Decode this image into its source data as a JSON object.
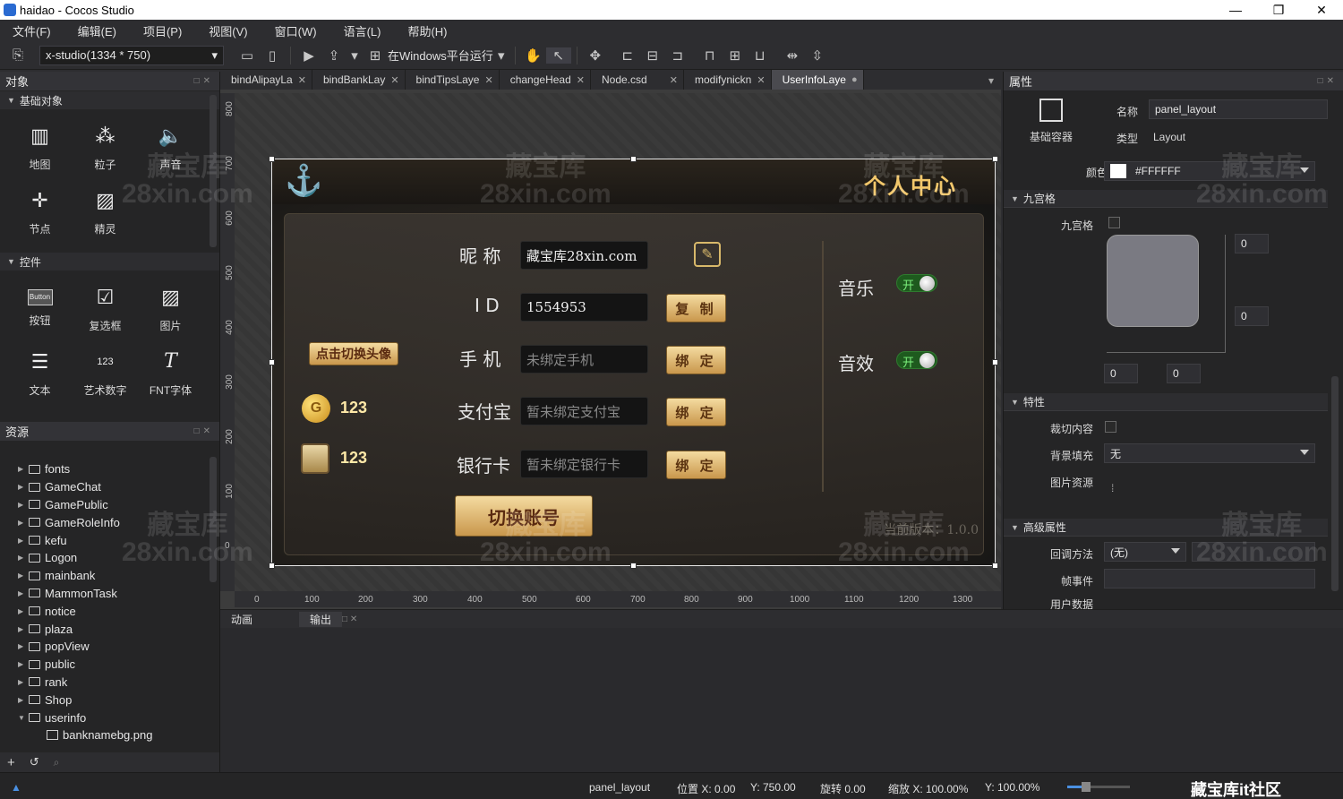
{
  "window": {
    "title": "haidao - Cocos Studio",
    "min": "—",
    "restore": "❐",
    "close": "✕"
  },
  "menu": [
    "文件(F)",
    "编辑(E)",
    "项目(P)",
    "视图(V)",
    "窗口(W)",
    "语言(L)",
    "帮助(H)"
  ],
  "toolbar": {
    "resolution": "x-studio(1334 * 750)",
    "run_label": "在Windows平台运行"
  },
  "left": {
    "objects_title": "对象",
    "basic_section": "基础对象",
    "basic_items": [
      {
        "label": "地图",
        "icon": "map-icon",
        "glyph": "▥"
      },
      {
        "label": "粒子",
        "icon": "particle-icon",
        "glyph": "⁂"
      },
      {
        "label": "声音",
        "icon": "sound-icon",
        "glyph": "🔈"
      },
      {
        "label": "节点",
        "icon": "node-icon",
        "glyph": "✛"
      },
      {
        "label": "精灵",
        "icon": "sprite-icon",
        "glyph": "▨"
      }
    ],
    "controls_section": "控件",
    "control_items": [
      {
        "label": "按钮",
        "icon": "button-icon",
        "glyph": "Button"
      },
      {
        "label": "复选框",
        "icon": "checkbox-icon",
        "glyph": "☑"
      },
      {
        "label": "图片",
        "icon": "image-icon",
        "glyph": "▨"
      },
      {
        "label": "文本",
        "icon": "text-icon",
        "glyph": "☰"
      },
      {
        "label": "艺术数字",
        "icon": "art-number-icon",
        "glyph": "123"
      },
      {
        "label": "FNT字体",
        "icon": "fnt-font-icon",
        "glyph": "T"
      }
    ],
    "resources_title": "资源",
    "resources": [
      {
        "name": "fonts",
        "type": "folder"
      },
      {
        "name": "GameChat",
        "type": "folder"
      },
      {
        "name": "GamePublic",
        "type": "folder"
      },
      {
        "name": "GameRoleInfo",
        "type": "folder"
      },
      {
        "name": "kefu",
        "type": "folder"
      },
      {
        "name": "Logon",
        "type": "folder"
      },
      {
        "name": "mainbank",
        "type": "folder"
      },
      {
        "name": "MammonTask",
        "type": "folder"
      },
      {
        "name": "notice",
        "type": "folder"
      },
      {
        "name": "plaza",
        "type": "folder"
      },
      {
        "name": "popView",
        "type": "folder"
      },
      {
        "name": "public",
        "type": "folder"
      },
      {
        "name": "rank",
        "type": "folder"
      },
      {
        "name": "Shop",
        "type": "folder"
      },
      {
        "name": "userinfo",
        "type": "folder-open"
      },
      {
        "name": "banknamebg.png",
        "type": "image"
      }
    ],
    "add_label": "+",
    "refresh_label": "↺"
  },
  "tabs": [
    {
      "label": "bindAlipayLa",
      "active": false
    },
    {
      "label": "bindBankLay",
      "active": false
    },
    {
      "label": "bindTipsLaye",
      "active": false
    },
    {
      "label": "changeHead",
      "active": false
    },
    {
      "label": "Node.csd",
      "active": false
    },
    {
      "label": "modifynickn",
      "active": false
    },
    {
      "label": "UserInfoLaye",
      "active": true
    }
  ],
  "ruler": {
    "v_labels": [
      "800",
      "700",
      "600",
      "500",
      "400",
      "300",
      "200",
      "100",
      "0"
    ],
    "h_labels": [
      "0",
      "100",
      "200",
      "300",
      "400",
      "500",
      "600",
      "700",
      "800",
      "900",
      "1000",
      "1100",
      "1200",
      "1300"
    ]
  },
  "design": {
    "banner_title": "个人中心",
    "nickname_label": "昵  称",
    "nickname_value": "藏宝库28xin.com",
    "id_label": "I  D",
    "id_value": "1554953",
    "copy_button": "复 制",
    "phone_label": "手  机",
    "phone_placeholder": "未绑定手机",
    "alipay_label": "支付宝",
    "alipay_placeholder": "暂未绑定支付宝",
    "bankcard_label": "银行卡",
    "bankcard_placeholder": "暂未绑定银行卡",
    "bind_button": "绑 定",
    "switch_avatar_button": "点击切换头像",
    "coin_amount": "123",
    "bank_amount": "123",
    "music_label": "音乐",
    "sfx_label": "音效",
    "toggle_on": "开",
    "switch_account_button": "切换账号",
    "version": "当前版本：1.0.0"
  },
  "bottom": {
    "anim_tab": "动画",
    "output_tab": "输出"
  },
  "props": {
    "title": "属性",
    "container_label": "基础容器",
    "name_label": "名称",
    "name_value": "panel_layout",
    "type_label": "类型",
    "type_value": "Layout",
    "color_label": "颜色",
    "color_value": "#FFFFFF",
    "nine_section": "九宫格",
    "nine_label": "九宫格",
    "nine_values": [
      "0",
      "0",
      "0",
      "0"
    ],
    "feature_section": "特性",
    "clip_label": "裁切内容",
    "bgfill_label": "背景填充",
    "bgfill_value": "无",
    "image_label": "图片资源",
    "advanced_section": "高级属性",
    "callback_label": "回调方法",
    "callback_value": "(无)",
    "frame_event_label": "帧事件",
    "user_data_label": "用户数据"
  },
  "status": {
    "node": "panel_layout",
    "position": "位置 X: 0.00",
    "pos_y": "Y: 750.00",
    "rotation": "旋转 0.00",
    "scale": "缩放 X: 100.00%",
    "scale_y": "Y: 100.00%",
    "community": "藏宝库it社区"
  },
  "watermark": [
    "藏宝库",
    "28xin.com"
  ]
}
